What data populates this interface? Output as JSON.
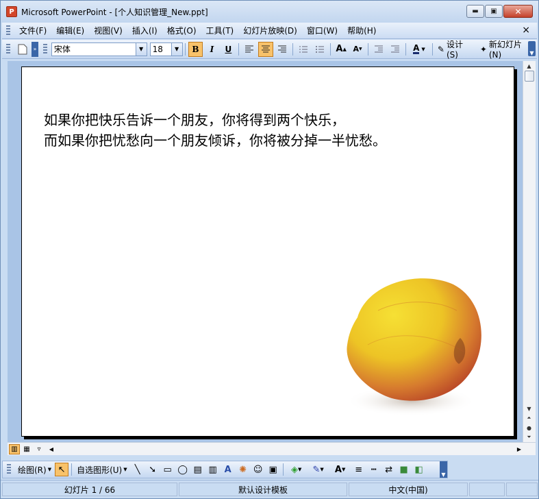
{
  "window": {
    "title": "Microsoft PowerPoint - [个人知识管理_New.ppt]",
    "app_icon_letter": "P",
    "minimize_glyph": "▬",
    "maximize_glyph": "▣",
    "close_glyph": "✕"
  },
  "menu": {
    "items": [
      "文件(F)",
      "编辑(E)",
      "视图(V)",
      "插入(I)",
      "格式(O)",
      "工具(T)",
      "幻灯片放映(D)",
      "窗口(W)",
      "帮助(H)"
    ],
    "doc_close_glyph": "×"
  },
  "toolbar": {
    "font_name": "宋体",
    "font_size": "18",
    "bold_label": "B",
    "italic_label": "I",
    "underline_label": "U",
    "font_color_label": "A",
    "design_label": "设计(S)",
    "new_slide_label": "新幻灯片(N)"
  },
  "slide": {
    "line1": "如果你把快乐告诉一个朋友，你将得到两个快乐，",
    "line2": "而如果你把忧愁向一个朋友倾诉，你将被分掉一半忧愁。"
  },
  "drawing_toolbar": {
    "draw_label": "绘图(R)",
    "autoshapes_label": "自选图形(U)"
  },
  "status": {
    "slide_position": "幻灯片 1 / 66",
    "template": "默认设计模板",
    "language": "中文(中国)"
  },
  "colors": {
    "accent_active": "#f8c26a",
    "toolbar_bg": "#c5d8f1",
    "apple_yellow": "#f2d21a",
    "apple_red": "#c8412b"
  }
}
